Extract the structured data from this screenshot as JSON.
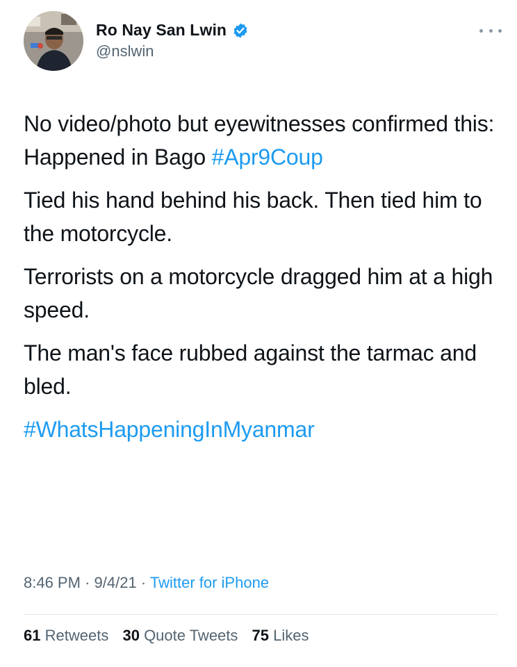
{
  "author": {
    "display_name": "Ro Nay San Lwin",
    "handle": "@nslwin",
    "verified": true,
    "avatar_icon": "profile-photo"
  },
  "tweet": {
    "p1_text": "No video/photo but eyewitnesses confirmed this: Happened in Bago",
    "p1_hashtag": "#Apr9Coup",
    "p2": "Tied his hand behind his back. Then tied him to the motorcycle.",
    "p3": "Terrorists on a motorcycle dragged him at a high speed.",
    "p4": "The man's face rubbed against the tarmac and bled.",
    "hashtag_2": "#WhatsHappeningInMyanmar"
  },
  "meta": {
    "time": "8:46 PM",
    "date": "9/4/21",
    "separator": "·",
    "source": "Twitter for iPhone"
  },
  "stats": {
    "retweets_count": "61",
    "retweets_label": "Retweets",
    "quotes_count": "30",
    "quotes_label": "Quote Tweets",
    "likes_count": "75",
    "likes_label": "Likes"
  },
  "colors": {
    "link": "#1d9bf0",
    "secondary_text": "#536471",
    "primary_text": "#0f1419"
  }
}
